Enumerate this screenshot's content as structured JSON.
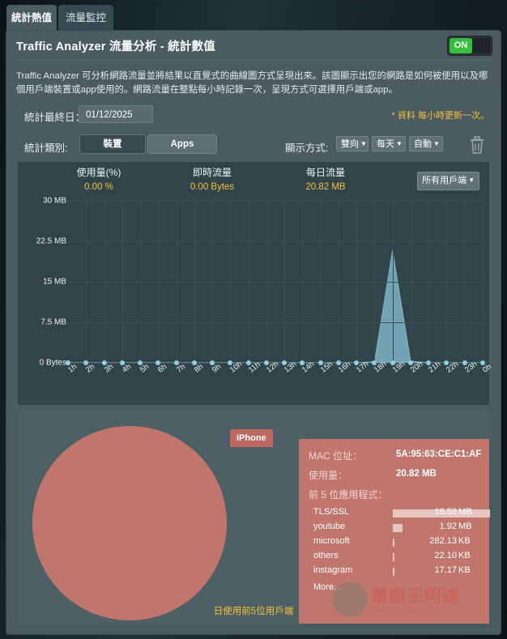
{
  "tabs": [
    {
      "label": "統計熱值",
      "active": true
    },
    {
      "label": "流量監控",
      "active": false
    }
  ],
  "header": {
    "title": "Traffic Analyzer 流量分析 - 統計數值",
    "toggle_label": "ON",
    "toggle_state": "on"
  },
  "description": "Traffic Analyzer 可分析網路流量並將結果以直覺式的曲線圖方式呈現出來。該圖顯示出您的網路是如何被使用以及哪個用戶端裝置或app使用的。網路流量在整點每小時記錄一次，呈現方式可選擇用戶端或app。",
  "date_row": {
    "label": "統計最終日：",
    "value": "01/12/2025",
    "note": "* 資料 每小時更新一次。"
  },
  "controls": {
    "category_label": "統計類別:",
    "category_buttons": [
      {
        "label": "裝置",
        "selected": true
      },
      {
        "label": "Apps",
        "selected": false
      }
    ],
    "display_label": "顯示方式:",
    "selects": [
      {
        "value": "雙向"
      },
      {
        "value": "每天"
      },
      {
        "value": "自動"
      }
    ],
    "trash_icon": "trash-icon"
  },
  "stats": [
    {
      "key": "使用量(%)",
      "value": "0.00 %"
    },
    {
      "key": "即時流量",
      "value": "0.00 Bytes"
    },
    {
      "key": "每日流量",
      "value": "20.82 MB"
    }
  ],
  "client_select": {
    "value": "所有用戶端"
  },
  "chart_data": {
    "type": "area",
    "title": "",
    "xlabel": "",
    "ylabel": "",
    "ylim": [
      0,
      30
    ],
    "yunit": "MB",
    "ytick_labels": [
      "30 MB",
      "22.5 MB",
      "15 MB",
      "7.5 MB",
      "0 Bytes"
    ],
    "ytick_values": [
      30,
      22.5,
      15,
      7.5,
      0
    ],
    "grid": true,
    "legend": "none",
    "categories": [
      "1h",
      "2h",
      "3h",
      "4h",
      "5h",
      "6h",
      "7h",
      "8h",
      "9h",
      "10h",
      "11h",
      "12h",
      "13h",
      "14h",
      "15h",
      "16h",
      "17h",
      "18h",
      "19h",
      "20h",
      "21h",
      "22h",
      "23h",
      "0h"
    ],
    "series": [
      {
        "name": "每日流量",
        "color": "#7fb4c6",
        "values": [
          0,
          0,
          0,
          0,
          0,
          0,
          0,
          0,
          0,
          0,
          0,
          0,
          0,
          0,
          0,
          0,
          0,
          0.2,
          20.82,
          0.3,
          0,
          0,
          0,
          0
        ]
      }
    ]
  },
  "bottom": {
    "device_tag": "iPhone",
    "pie_color": "#c0766d",
    "info": {
      "mac_label": "MAC 位址：",
      "mac_value": "5A:95:63:CE:C1:AF",
      "usage_label": "使用量：",
      "usage_value": "20.82 MB",
      "top5_label": "前 5 位應用程式："
    },
    "apps": [
      {
        "name": "TLS/SSL",
        "value": "18.58",
        "unit": "MB",
        "bar_pct": 100
      },
      {
        "name": "youtube",
        "value": "1.92",
        "unit": "MB",
        "bar_pct": 10
      },
      {
        "name": "microsoft",
        "value": "282.13",
        "unit": "KB",
        "bar_pct": 1.5
      },
      {
        "name": "others",
        "value": "22.10",
        "unit": "KB",
        "bar_pct": 1.5
      },
      {
        "name": "instagram",
        "value": "17.17",
        "unit": "KB",
        "bar_pct": 1.5
      }
    ],
    "more_label": "More...",
    "caption": "日使用前5位用戶端"
  },
  "watermark": {
    "text": "電腦王阿達",
    "url": "http://www.kocpc.com.tw"
  }
}
